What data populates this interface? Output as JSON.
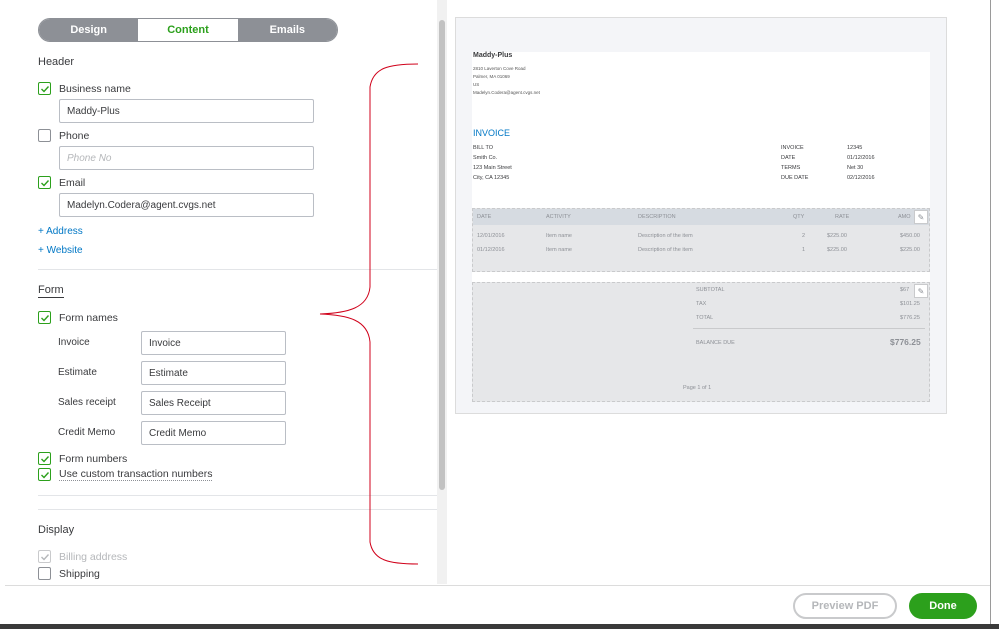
{
  "tabs": [
    {
      "label": "Design"
    },
    {
      "label": "Content"
    },
    {
      "label": "Emails"
    }
  ],
  "header": {
    "title": "Header",
    "business_name": {
      "label": "Business name",
      "checked": true,
      "value": "Maddy-Plus"
    },
    "phone": {
      "label": "Phone",
      "checked": false,
      "placeholder": "Phone No"
    },
    "email": {
      "label": "Email",
      "checked": true,
      "value": "Madelyn.Codera@agent.cvgs.net"
    },
    "add_address": "+ Address",
    "add_website": "+ Website"
  },
  "form": {
    "title": "Form",
    "form_names": {
      "label": "Form names",
      "checked": true
    },
    "names": [
      {
        "label": "Invoice",
        "value": "Invoice"
      },
      {
        "label": "Estimate",
        "value": "Estimate"
      },
      {
        "label": "Sales receipt",
        "value": "Sales Receipt"
      },
      {
        "label": "Credit Memo",
        "value": "Credit Memo"
      }
    ],
    "form_numbers": {
      "label": "Form numbers",
      "checked": true
    },
    "custom_numbers": {
      "label": "Use custom transaction numbers",
      "checked": true
    }
  },
  "display": {
    "title": "Display",
    "billing_address": {
      "label": "Billing address",
      "checked": true
    },
    "shipping": {
      "label": "Shipping",
      "checked": false
    }
  },
  "preview": {
    "business": "Maddy-Plus",
    "address_lines": [
      "2810 Laverton Cove Road",
      "Palmer, MA 01069",
      "US",
      "Madelyn.Codera@agent.cvgs.net"
    ],
    "invoice_title": "INVOICE",
    "bill_to_label": "BILL TO",
    "bill_to": [
      "Smith Co.",
      "123 Main Street",
      "City, CA 12345"
    ],
    "meta_labels": [
      "INVOICE",
      "DATE",
      "TERMS",
      "DUE DATE"
    ],
    "meta_values": [
      "12345",
      "01/12/2016",
      "Net 30",
      "02/12/2016"
    ],
    "columns": [
      "DATE",
      "ACTIVITY",
      "DESCRIPTION",
      "QTY",
      "RATE",
      "AMO"
    ],
    "rows": [
      [
        "12/01/2016",
        "Item name",
        "Description of the item",
        "2",
        "$225.00",
        "$450.00"
      ],
      [
        "01/12/2016",
        "Item name",
        "Description of the item",
        "1",
        "$225.00",
        "$225.00"
      ]
    ],
    "subtotal_label": "SUBTOTAL",
    "subtotal_value": "$67",
    "tax_label": "TAX",
    "tax_value": "$101.25",
    "total_label": "TOTAL",
    "total_value": "$776.25",
    "balance_label": "BALANCE DUE",
    "balance_value": "$776.25",
    "page_label": "Page 1 of 1"
  },
  "footer": {
    "preview_pdf": "Preview PDF",
    "done": "Done"
  },
  "colors": {
    "accent": "#2ca01c",
    "link": "#0077c5",
    "brace": "#d0021b"
  }
}
